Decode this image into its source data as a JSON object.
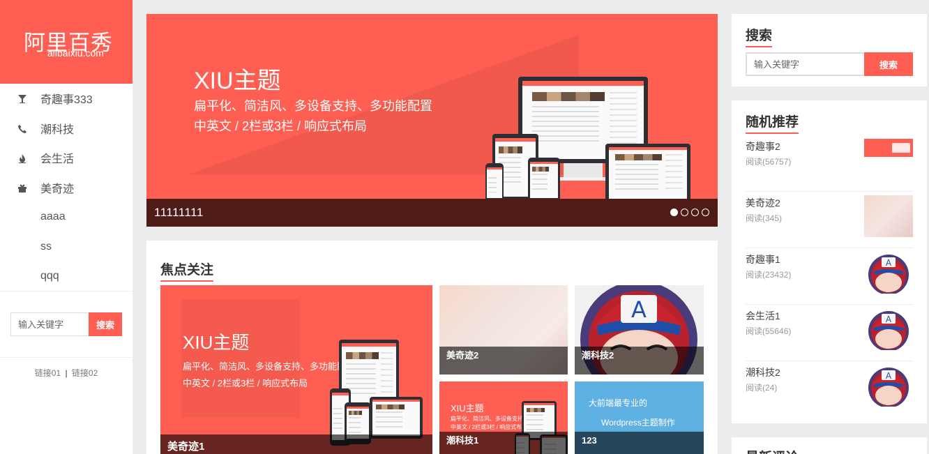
{
  "site": {
    "name_cn": "阿里百秀",
    "name_en": "alibaixiu.com"
  },
  "nav": [
    {
      "label": "奇趣事333",
      "icon": "glass-icon"
    },
    {
      "label": "潮科技",
      "icon": "phone-icon"
    },
    {
      "label": "会生活",
      "icon": "fire-icon"
    },
    {
      "label": "美奇迹",
      "icon": "gift-icon"
    },
    {
      "label": "aaaa",
      "icon": ""
    },
    {
      "label": "ss",
      "icon": ""
    },
    {
      "label": "qqq",
      "icon": ""
    }
  ],
  "sidebar_search": {
    "placeholder": "输入关键字",
    "button": "搜索"
  },
  "sidebar_links": [
    "链接01",
    "|",
    "链接02"
  ],
  "slider": {
    "title": "XIU主题",
    "subtitle_1": "扁平化、简洁风、多设备支持、多功能配置",
    "subtitle_2": "中英文 / 2栏或3栏 / 响应式布局",
    "caption": "11111111",
    "active_index": 0,
    "count": 4
  },
  "focus": {
    "title": "焦点关注",
    "items": [
      {
        "caption": "美奇迹1",
        "xiu": "XIU主题",
        "sub1": "扁平化、简洁风、多设备支持、多功能配置",
        "sub2": "中英文 / 2栏或3栏 / 响应式布局"
      },
      {
        "caption": "美奇迹2"
      },
      {
        "caption": "潮科技2"
      },
      {
        "caption": "潮科技1",
        "xiu": "XIU主题",
        "sub1": "扁平化、简洁风、多设备支持、多功能配置",
        "sub2": "中英文 / 2栏或3栏 / 响应式布局"
      },
      {
        "caption": "123",
        "banner_1": "大前端最专业的",
        "banner_2": "Wordpress主题制作"
      }
    ]
  },
  "search": {
    "title": "搜索",
    "placeholder": "输入关键字",
    "button": "搜索"
  },
  "recommend": {
    "title": "随机推荐",
    "items": [
      {
        "title": "奇趣事2",
        "meta": "阅读(56757)"
      },
      {
        "title": "美奇迹2",
        "meta": "阅读(345)"
      },
      {
        "title": "奇趣事1",
        "meta": "阅读(23432)"
      },
      {
        "title": "会生活1",
        "meta": "阅读(55646)"
      },
      {
        "title": "潮科技2",
        "meta": "阅读(24)"
      }
    ]
  },
  "comments": {
    "title": "最新评论"
  },
  "colors": {
    "accent": "#ff5e52",
    "caption_bg": "#4e1b17",
    "page_bg": "#ececec"
  }
}
